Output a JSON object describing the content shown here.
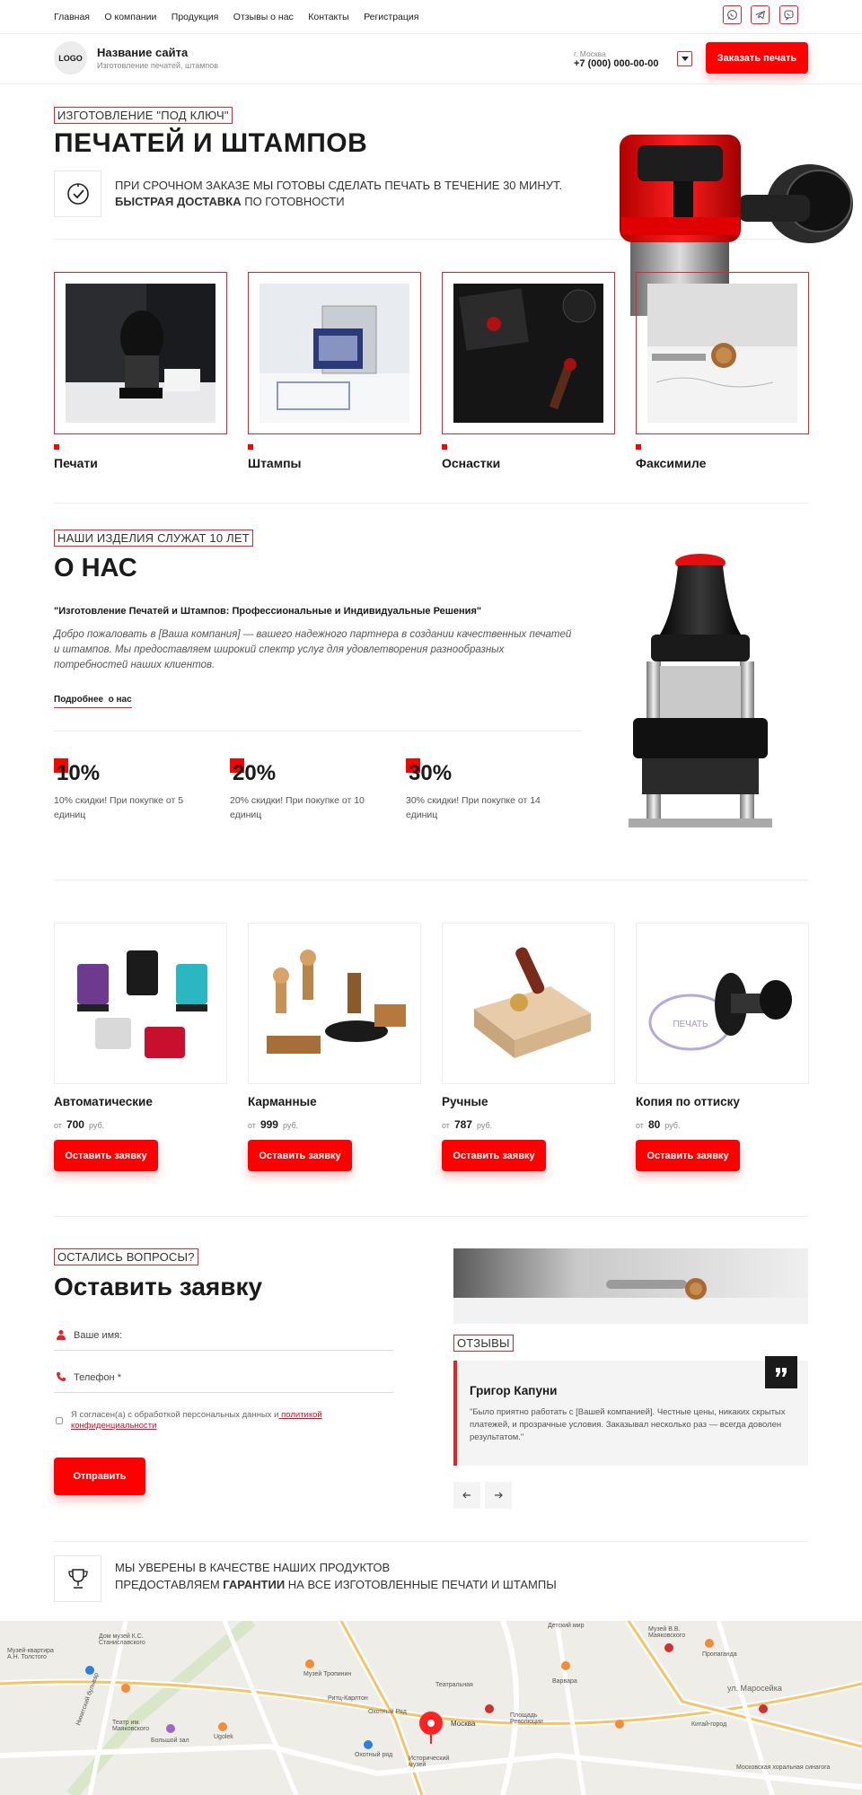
{
  "topnav": {
    "items": [
      "Главная",
      "О компании",
      "Продукция",
      "Отзывы о нас",
      "Контакты",
      "Регистрация"
    ],
    "social_icons": [
      "whatsapp-icon",
      "telegram-icon",
      "viber-icon"
    ]
  },
  "header": {
    "logo": "LOGO",
    "site_name": "Название сайта",
    "site_tagline": "Изготовление печатей, штампов",
    "city": "г. Москва",
    "phone": "+7 (000) 000-00-00",
    "order_button": "Заказать печать"
  },
  "hero": {
    "label": "ИЗГОТОВЛЕНИЕ \"ПОД КЛЮЧ\"",
    "title": "ПЕЧАТЕЙ И ШТАМПОВ",
    "line1": "ПРИ СРОЧНОМ ЗАКАЗЕ МЫ ГОТОВЫ СДЕЛАТЬ ПЕЧАТЬ В ТЕЧЕНИЕ 30 МИНУТ.",
    "line2_bold": "БЫСТРАЯ ДОСТАВКА",
    "line2_rest": " ПО ГОТОВНОСТИ"
  },
  "categories": [
    {
      "label": "Печати"
    },
    {
      "label": "Штампы"
    },
    {
      "label": "Оснастки"
    },
    {
      "label": "Факсимиле"
    }
  ],
  "about": {
    "label": "НАШИ ИЗДЕЛИЯ СЛУЖАТ 10 ЛЕТ",
    "title": "О НАС",
    "subtitle": "\"Изготовление Печатей и Штампов: Профессиональные и Индивидуальные Решения\"",
    "text": "Добро пожаловать в [Ваша компания] — вашего надежного партнера в создании качественных печатей и штампов. Мы предоставляем широкий спектр услуг для удовлетворения разнообразных потребностей наших клиентов.",
    "more_link": "Подробнее  о нас",
    "stats": [
      {
        "value": "10%",
        "desc": "10% скидки! При покупке от 5 единиц"
      },
      {
        "value": "20%",
        "desc": "20% скидки! При покупке от 10 единиц"
      },
      {
        "value": "30%",
        "desc": "30% скидки! При покупке от 14 единиц"
      }
    ]
  },
  "products": {
    "price_prefix": "от",
    "currency": "руб.",
    "button": "Оставить заявку",
    "items": [
      {
        "name": "Автоматические",
        "price": "700"
      },
      {
        "name": "Карманные",
        "price": "999"
      },
      {
        "name": "Ручные",
        "price": "787"
      },
      {
        "name": "Копия по оттиску",
        "price": "80"
      }
    ]
  },
  "form": {
    "label": "ОСТАЛИСЬ ВОПРОСЫ?",
    "title": "Оставить заявку",
    "name_placeholder": "Ваше имя:",
    "phone_placeholder": "Телефон *",
    "consent_text": "Я согласен(а) с обработкой персональных данных и",
    "consent_link": " политикой конфиденциальности",
    "submit": "Отправить"
  },
  "reviews": {
    "label": "ОТЗЫВЫ",
    "author": "Григор Капуни",
    "text": "\"Было приятно работать с [Вашей компанией]. Честные цены, никаких скрытых платежей, и прозрачные условия. Заказывал несколько раз — всегда доволен результатом.\""
  },
  "guarantee": {
    "line1": "МЫ УВЕРЕНЫ В КАЧЕСТВЕ НАШИХ ПРОДУКТОВ",
    "line2_pre": "ПРЕДОСТАВЛЯЕМ ",
    "line2_bold": "ГАРАНТИИ",
    "line2_post": " НА ВСЕ ИЗГОТОВЛЕННЫЕ ПЕЧАТИ И ШТАМПЫ"
  },
  "map": {
    "labels": [
      "Музей-квартира А.Н. Толстого",
      "Дом музей К.С. Станиславского",
      "Театр им. Маяковского",
      "Большой зал",
      "Музей Тропинин",
      "Ритц-Карлтон",
      "Охотный Ряд",
      "Театральная",
      "Москва",
      "Площадь Революции",
      "Детский мир",
      "Музей В.В. Маяковского",
      "Пропаганда",
      "ул. Маросейка",
      "Китай-город",
      "Исторический музей",
      "Охотный ряд",
      "Ugolek",
      "Варвара",
      "Московская хоральная синагога",
      "Никитский бульвар"
    ]
  }
}
